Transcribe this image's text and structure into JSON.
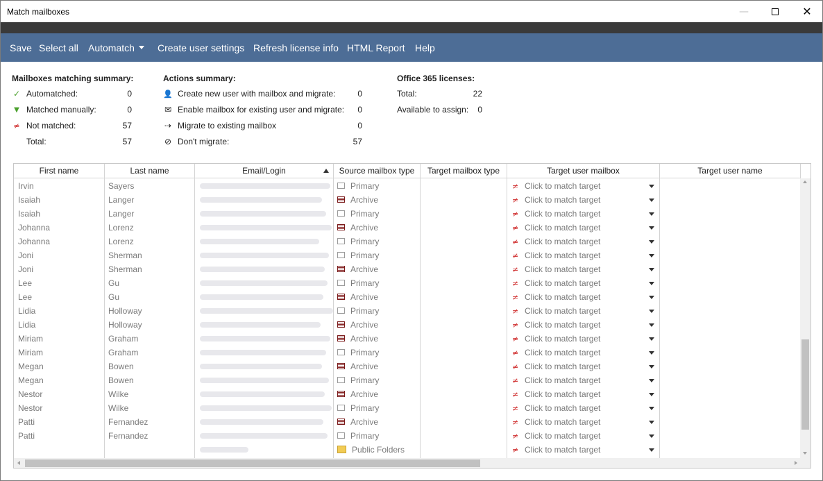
{
  "window": {
    "title": "Match mailboxes"
  },
  "menu": {
    "save": "Save",
    "select_all": "Select all",
    "automatch": "Automatch",
    "create_user_settings": "Create user settings",
    "refresh_license_info": "Refresh license info",
    "html_report": "HTML Report",
    "help": "Help"
  },
  "matching_summary": {
    "title": "Mailboxes matching summary:",
    "automatched_label": "Automatched:",
    "automatched_value": "0",
    "matched_manually_label": "Matched manually:",
    "matched_manually_value": "0",
    "not_matched_label": "Not matched:",
    "not_matched_value": "57",
    "total_label": "Total:",
    "total_value": "57"
  },
  "actions_summary": {
    "title": "Actions summary:",
    "create_new_label": "Create new user with mailbox and migrate:",
    "create_new_value": "0",
    "enable_mailbox_label": "Enable mailbox for existing user and migrate:",
    "enable_mailbox_value": "0",
    "migrate_existing_label": "Migrate to existing mailbox",
    "migrate_existing_value": "0",
    "dont_migrate_label": "Don't migrate:",
    "dont_migrate_value": "57"
  },
  "licenses": {
    "title": "Office 365 licenses:",
    "total_label": "Total:",
    "total_value": "22",
    "available_label": "Available to assign:",
    "available_value": "0"
  },
  "table": {
    "columns": {
      "first_name": "First name",
      "last_name": "Last name",
      "email": "Email/Login",
      "source_type": "Source mailbox type",
      "target_type": "Target mailbox type",
      "target_mailbox": "Target user mailbox",
      "target_user_name": "Target user name"
    },
    "target_placeholder": "Click to match target",
    "rows": [
      {
        "first": "Irvin",
        "last": "Sayers",
        "type": "Primary"
      },
      {
        "first": "Isaiah",
        "last": "Langer",
        "type": "Archive"
      },
      {
        "first": "Isaiah",
        "last": "Langer",
        "type": "Primary"
      },
      {
        "first": "Johanna",
        "last": "Lorenz",
        "type": "Archive"
      },
      {
        "first": "Johanna",
        "last": "Lorenz",
        "type": "Primary"
      },
      {
        "first": "Joni",
        "last": "Sherman",
        "type": "Primary"
      },
      {
        "first": "Joni",
        "last": "Sherman",
        "type": "Archive"
      },
      {
        "first": "Lee",
        "last": "Gu",
        "type": "Primary"
      },
      {
        "first": "Lee",
        "last": "Gu",
        "type": "Archive"
      },
      {
        "first": "Lidia",
        "last": "Holloway",
        "type": "Primary"
      },
      {
        "first": "Lidia",
        "last": "Holloway",
        "type": "Archive"
      },
      {
        "first": "Miriam",
        "last": "Graham",
        "type": "Archive"
      },
      {
        "first": "Miriam",
        "last": "Graham",
        "type": "Primary"
      },
      {
        "first": "Megan",
        "last": "Bowen",
        "type": "Archive"
      },
      {
        "first": "Megan",
        "last": "Bowen",
        "type": "Primary"
      },
      {
        "first": "Nestor",
        "last": "Wilke",
        "type": "Archive"
      },
      {
        "first": "Nestor",
        "last": "Wilke",
        "type": "Primary"
      },
      {
        "first": "Patti",
        "last": "Fernandez",
        "type": "Archive"
      },
      {
        "first": "Patti",
        "last": "Fernandez",
        "type": "Primary"
      },
      {
        "first": "",
        "last": "",
        "type": "Public Folders"
      }
    ]
  }
}
